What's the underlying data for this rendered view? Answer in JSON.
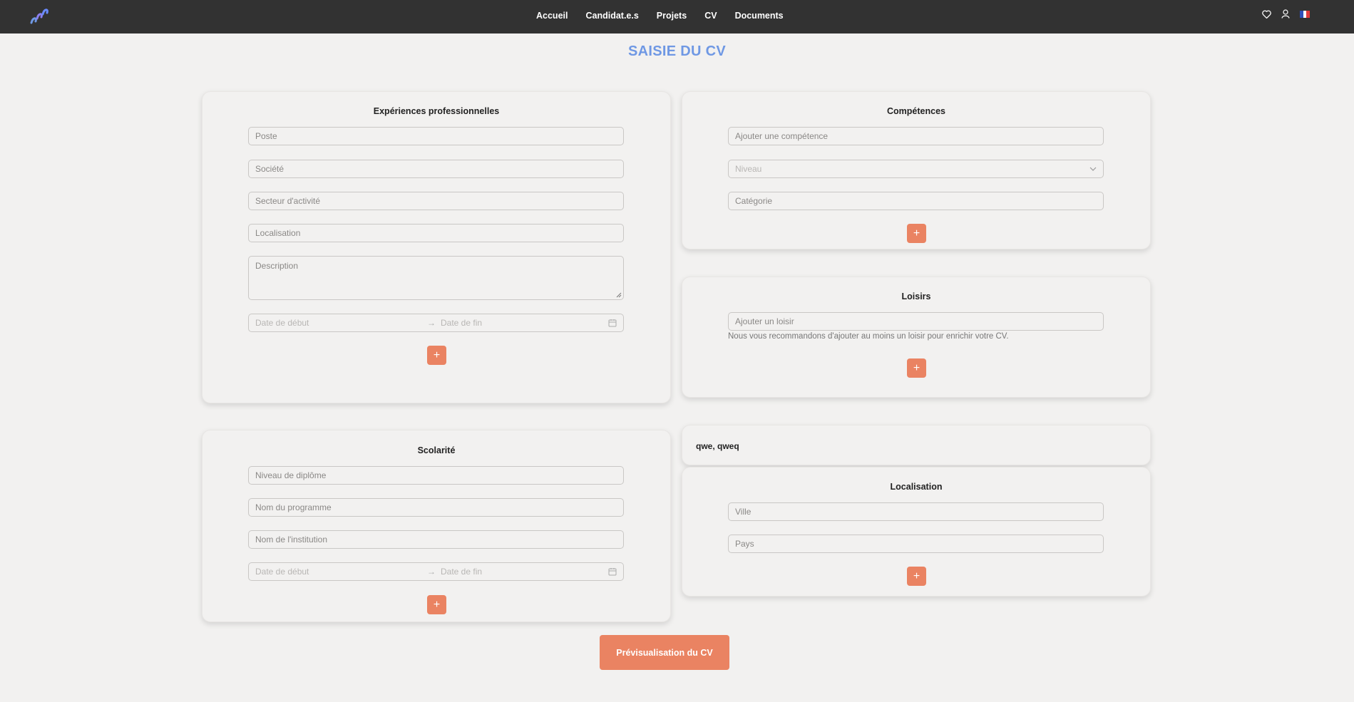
{
  "nav": {
    "items": [
      "Accueil",
      "Candidat.e.s",
      "Projets",
      "CV",
      "Documents"
    ]
  },
  "icons": {
    "logo": "logo-icon",
    "favorites": "heart-icon",
    "account": "user-icon",
    "language": "french-flag-icon"
  },
  "colors": {
    "topbar": "#323232",
    "accent": "#ea8362",
    "title": "#6f98e4",
    "background": "#f2f1f0"
  },
  "page": {
    "title": "SAISIE DU CV"
  },
  "experience": {
    "title": "Expériences professionnelles",
    "poste_placeholder": "Poste",
    "societe_placeholder": "Société",
    "secteur_placeholder": "Secteur d'activité",
    "localisation_placeholder": "Localisation",
    "description_placeholder": "Description",
    "date_debut_placeholder": "Date de début",
    "date_fin_placeholder": "Date de fin",
    "add_label": "+"
  },
  "competences": {
    "title": "Compétences",
    "competence_placeholder": "Ajouter une compétence",
    "niveau_placeholder": "Niveau",
    "categorie_placeholder": "Catégorie",
    "add_label": "+"
  },
  "loisirs": {
    "title": "Loisirs",
    "loisir_placeholder": "Ajouter un loisir",
    "hint": "Nous vous recommandons d'ajouter au moins un loisir pour enrichir votre CV.",
    "add_label": "+"
  },
  "scolarite": {
    "title": "Scolarité",
    "niveau_placeholder": "Niveau de diplôme",
    "programme_placeholder": "Nom du programme",
    "institution_placeholder": "Nom de l'institution",
    "date_debut_placeholder": "Date de début",
    "date_fin_placeholder": "Date de fin",
    "add_label": "+"
  },
  "tags_card": {
    "text": "qwe, qweq"
  },
  "localisation": {
    "title": "Localisation",
    "ville_placeholder": "Ville",
    "pays_placeholder": "Pays",
    "add_label": "+"
  },
  "preview_button": {
    "label": "Prévisualisation du CV"
  }
}
